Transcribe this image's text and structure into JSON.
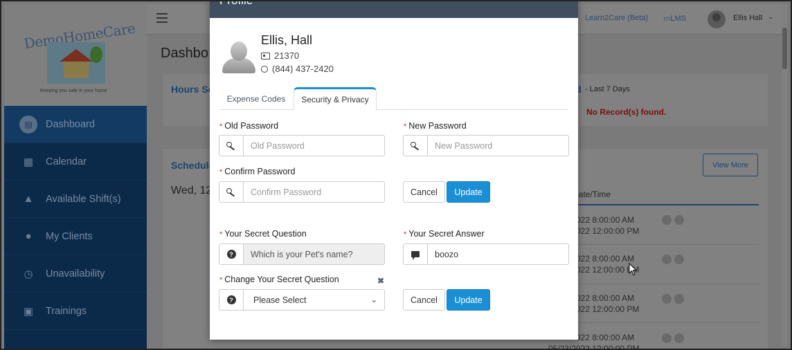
{
  "sidebar": {
    "logo_text": "DemoHomeCare",
    "logo_tagline": "Keeping you safe in your home",
    "items": [
      {
        "label": "Dashboard",
        "icon": "dashboard-icon"
      },
      {
        "label": "Calendar",
        "icon": "calendar-icon"
      },
      {
        "label": "Available Shift(s)",
        "icon": "shift-icon"
      },
      {
        "label": "My Clients",
        "icon": "clients-icon"
      },
      {
        "label": "Unavailability",
        "icon": "unavailability-icon"
      },
      {
        "label": "Trainings",
        "icon": "trainings-icon"
      }
    ]
  },
  "topbar": {
    "learn_link": "Learn2Care (Beta)",
    "lms_link": "LMS",
    "user_name": "Ellis Hall"
  },
  "page": {
    "title": "Dashbo",
    "hours_card_title": "Hours Se",
    "right_card_title_part": "d",
    "right_card_subtitle": "- Last 7 Days",
    "no_records": "No Record(s) found.",
    "schedule_title": "Schedule",
    "schedule_date": "Wed, 12",
    "view_more": "View More",
    "table_header": "d Date/Time",
    "rows": [
      {
        "line1": "022 8:00:00 AM",
        "line2": "022 12:00:00 PM"
      },
      {
        "line1": "022 8:00:00 AM",
        "line2": "022 12:00:00 PM"
      },
      {
        "line1": "022 8:00:00 AM",
        "line2": "022 12:00:00 PM"
      },
      {
        "line1": "022 8:00:00 AM",
        "line2": "05/23/2022 12:00:00 PM"
      }
    ]
  },
  "modal": {
    "title": "Profile",
    "profile": {
      "name": "Ellis, Hall",
      "employee_id": "21370",
      "phone": "(844) 437-2420"
    },
    "tabs": [
      {
        "label": "Expense Codes",
        "active": false
      },
      {
        "label": "Security & Privacy",
        "active": true
      }
    ],
    "old_password": {
      "label": "Old Password",
      "placeholder": "Old Password",
      "value": ""
    },
    "new_password": {
      "label": "New Password",
      "placeholder": "New Password",
      "value": ""
    },
    "confirm_password": {
      "label": "Confirm Password",
      "placeholder": "Confirm Password",
      "value": ""
    },
    "password_cancel": "Cancel",
    "password_update": "Update",
    "secret_question": {
      "label": "Your Secret Question",
      "value": "Which is your Pet's name?"
    },
    "secret_answer": {
      "label": "Your Secret Answer",
      "value": "boozo"
    },
    "change_question": {
      "label": "Change Your Secret Question",
      "selected": "Please Select"
    },
    "question_cancel": "Cancel",
    "question_update": "Update"
  },
  "colors": {
    "accent": "#1a8fd6",
    "sidebar_bg": "#0b2a4a",
    "modal_header": "#3f4f5f",
    "required": "#dd2222"
  }
}
